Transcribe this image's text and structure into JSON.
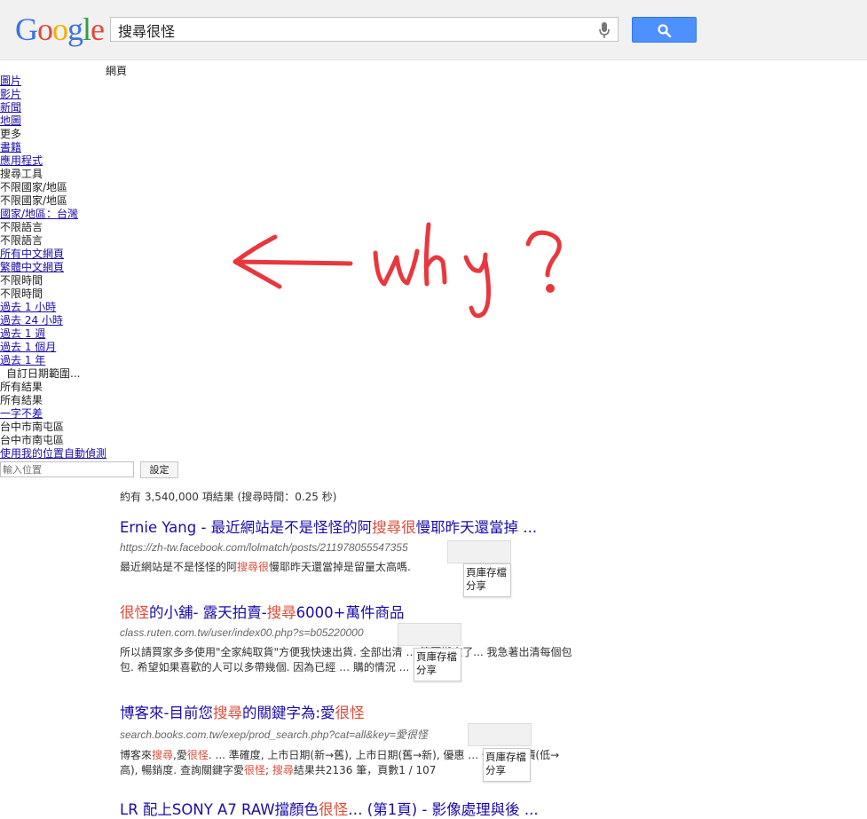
{
  "header": {
    "logo": "Google",
    "search_value": "搜尋很怪",
    "brand_blue": "#4d90fe"
  },
  "tabs": {
    "web": "網頁"
  },
  "leftnav": [
    {
      "label": "圖片",
      "link": true
    },
    {
      "label": "影片",
      "link": true
    },
    {
      "label": "新聞",
      "link": true
    },
    {
      "label": "地圖",
      "link": true
    },
    {
      "label": "更多",
      "link": false
    },
    {
      "label": "書籍",
      "link": true
    },
    {
      "label": "應用程式",
      "link": true
    },
    {
      "label": "搜尋工具",
      "link": false
    },
    {
      "label": "不限國家/地區",
      "link": false
    },
    {
      "label": "不限國家/地區",
      "link": false
    },
    {
      "label": "國家/地區：台灣",
      "link": true
    },
    {
      "label": "不限語言",
      "link": false
    },
    {
      "label": "不限語言",
      "link": false
    },
    {
      "label": "所有中文網頁",
      "link": true
    },
    {
      "label": "繁體中文網頁",
      "link": true
    },
    {
      "label": "不限時間",
      "link": false
    },
    {
      "label": "不限時間",
      "link": false
    },
    {
      "label": "過去 1 小時",
      "link": true
    },
    {
      "label": "過去 24 小時",
      "link": true
    },
    {
      "label": "過去 1 週",
      "link": true
    },
    {
      "label": "過去 1 個月",
      "link": true
    },
    {
      "label": "過去 1 年",
      "link": true
    },
    {
      "label": "自訂日期範圍...",
      "link": false,
      "indent": true
    },
    {
      "label": "所有結果",
      "link": false
    },
    {
      "label": "所有結果",
      "link": false
    },
    {
      "label": "一字不差",
      "link": true
    },
    {
      "label": "台中市南屯區",
      "link": false
    },
    {
      "label": "台中市南屯區",
      "link": false
    },
    {
      "label": "使用我的位置自動偵測",
      "link": true
    }
  ],
  "location": {
    "placeholder": "輸入位置",
    "set_label": "設定"
  },
  "stats": "約有 3,540,000 項結果 (搜尋時間：0.25 秒)",
  "results": [
    {
      "title_parts": [
        {
          "t": "Ernie Yang - 最近網站是不是怪怪的阿",
          "hl": false
        },
        {
          "t": "搜尋很",
          "hl": true
        },
        {
          "t": "慢耶昨天還當掉 ...",
          "hl": false
        }
      ],
      "url": "https://zh-tw.facebook.com/lolmatch/posts/211978055547355",
      "snippet_parts": [
        {
          "t": "最近網站是不是怪怪的阿",
          "hl": false
        },
        {
          "t": "搜尋很",
          "hl": true
        },
        {
          "t": "慢耶昨天還當掉是留量太高嗎.",
          "hl": false
        }
      ],
      "menu": [
        "頁庫存檔",
        "分享"
      ]
    },
    {
      "title_parts": [
        {
          "t": "很怪",
          "hl": true
        },
        {
          "t": "的小舖- 露天拍賣-",
          "hl": false
        },
        {
          "t": "搜尋",
          "hl": true
        },
        {
          "t": "6000+萬件商品",
          "hl": false
        }
      ],
      "url": "class.ruten.com.tw/user/index00.php?s=b05220000",
      "snippet_parts": [
        {
          "t": "所以請買家多多使用\"全家純取貨\"方便我快速出貨. 全部出清 … 算要搬家了... 我急著出清每個包包. 希望如果喜歡的人可以多帶幾個. 因為已經 … 購的情況 ...",
          "hl": false
        }
      ],
      "menu": [
        "頁庫存檔",
        "分享"
      ]
    },
    {
      "title_parts": [
        {
          "t": "博客來-目前您",
          "hl": false
        },
        {
          "t": "搜尋",
          "hl": true
        },
        {
          "t": "的關鍵字為:愛",
          "hl": false
        },
        {
          "t": "很怪",
          "hl": true
        }
      ],
      "url": "search.books.com.tw/exep/prod_search.php?cat=all&key=愛很怪",
      "snippet_parts": [
        {
          "t": "博客來",
          "hl": false
        },
        {
          "t": "搜尋",
          "hl": true
        },
        {
          "t": ",愛",
          "hl": false
        },
        {
          "t": "很怪",
          "hl": true
        },
        {
          "t": ". ... 準確度, 上市日期(新→舊), 上市日期(舊→新), 優惠 … 低), 優惠價(低→高), 暢銷度. 查詢關鍵字愛",
          "hl": false
        },
        {
          "t": "很怪",
          "hl": true
        },
        {
          "t": "; ",
          "hl": false
        },
        {
          "t": "搜尋",
          "hl": true
        },
        {
          "t": "結果共2136 筆，頁數1 / 107",
          "hl": false
        }
      ],
      "menu": [
        "頁庫存檔",
        "分享"
      ]
    },
    {
      "title_parts": [
        {
          "t": "LR 配上SONY A7 RAW擋顏色",
          "hl": false
        },
        {
          "t": "很怪",
          "hl": true
        },
        {
          "t": "… (第1頁) - 影像處理與後 ...",
          "hl": false
        }
      ],
      "url": "",
      "snippet_parts": [],
      "menu": []
    }
  ],
  "annotation": {
    "text": "why ?",
    "color": "#e8383d"
  }
}
